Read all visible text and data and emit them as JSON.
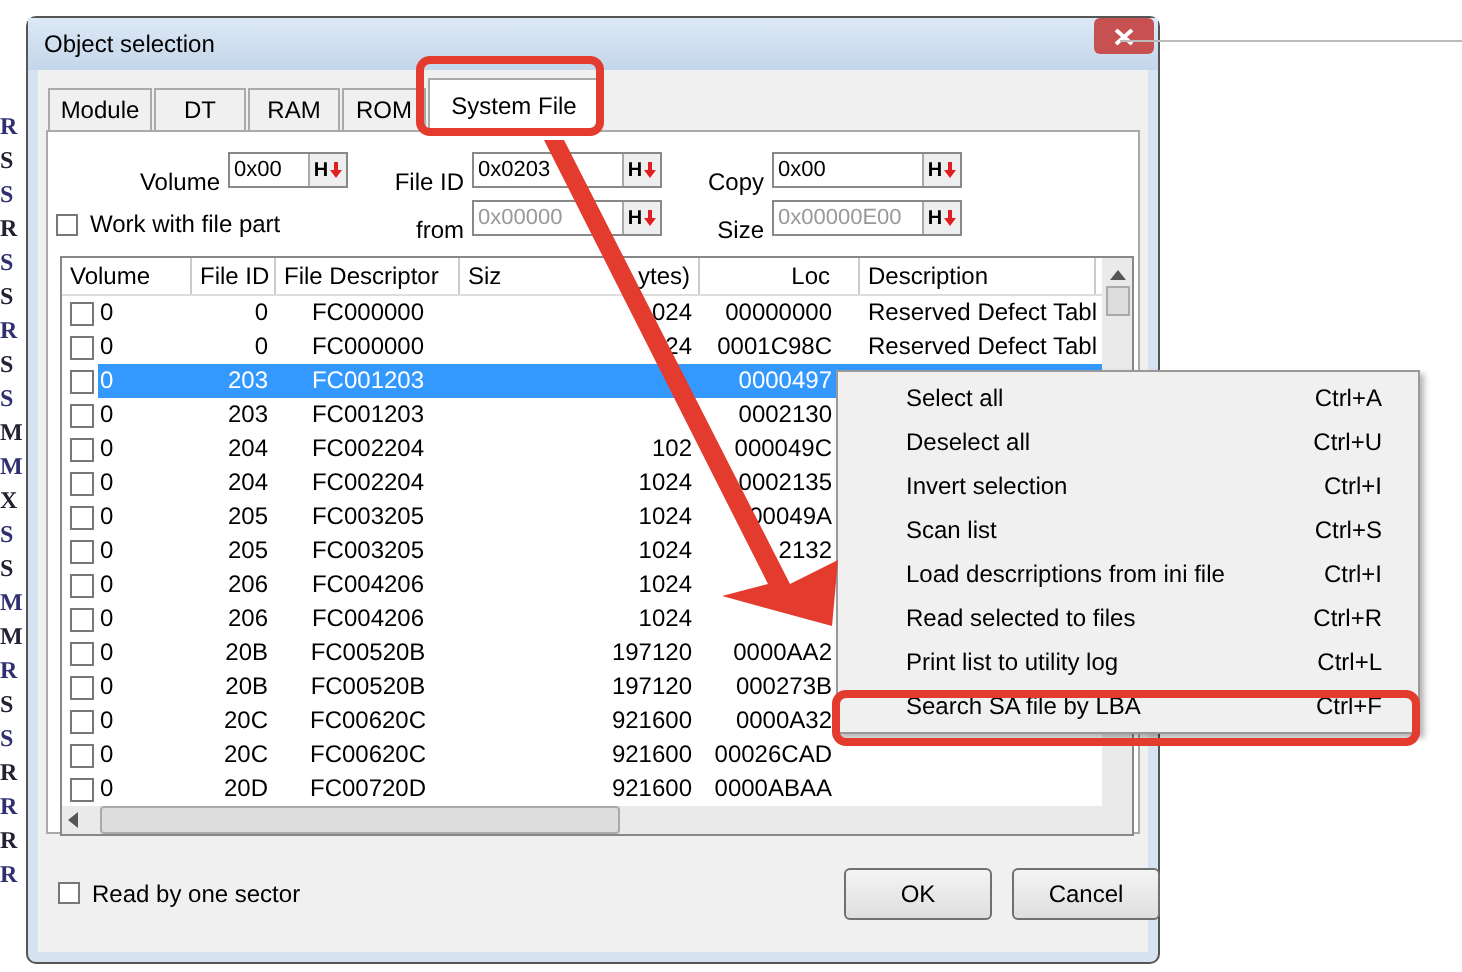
{
  "background_letters": [
    "R",
    "S",
    "S",
    "R",
    "S",
    "S",
    "R",
    "S",
    "S",
    "M",
    "M",
    "X",
    "S",
    "S",
    "M",
    "M",
    "R",
    "S",
    "S",
    "R",
    "R",
    "R",
    "R"
  ],
  "window": {
    "title": "Object selection"
  },
  "tabs": [
    {
      "label": "Module",
      "selected": false
    },
    {
      "label": "DT",
      "selected": false
    },
    {
      "label": "RAM",
      "selected": false
    },
    {
      "label": "ROM",
      "selected": false
    },
    {
      "label": "System File",
      "selected": true
    }
  ],
  "fields_row1": [
    {
      "label": "Volume",
      "value": "0x00",
      "disabled": false,
      "button": "H"
    },
    {
      "label": "File ID",
      "value": "0x0203",
      "disabled": false,
      "button": "H"
    },
    {
      "label": "Copy",
      "value": "0x00",
      "disabled": false,
      "button": "H"
    }
  ],
  "work_with_file_part": {
    "label": "Work with file part",
    "checked": false
  },
  "fields_row2": [
    {
      "label": "from",
      "value": "0x00000",
      "disabled": true,
      "button": "H"
    },
    {
      "label": "Size",
      "value": "0x00000E00",
      "disabled": true,
      "button": "H"
    }
  ],
  "table": {
    "columns": [
      "Volume",
      "File ID",
      "File Descriptor",
      "Siz",
      "Loc",
      "Description"
    ],
    "size_header_tail": "ytes)",
    "rows": [
      {
        "checked": false,
        "selected": false,
        "volume": "0",
        "file_id": "0",
        "descriptor": "FC000000",
        "size": "024",
        "loc": "00000000",
        "description": "Reserved Defect Tabl"
      },
      {
        "checked": false,
        "selected": false,
        "volume": "0",
        "file_id": "0",
        "descriptor": "FC000000",
        "size": "24",
        "loc": "0001C98C",
        "description": "Reserved Defect Tabl"
      },
      {
        "checked": false,
        "selected": true,
        "volume": "0",
        "file_id": "203",
        "descriptor": "FC001203",
        "loc": "0000497"
      },
      {
        "checked": false,
        "selected": false,
        "volume": "0",
        "file_id": "203",
        "descriptor": "FC001203",
        "loc": "0002130"
      },
      {
        "checked": false,
        "selected": false,
        "volume": "0",
        "file_id": "204",
        "descriptor": "FC002204",
        "size": "102",
        "loc": "000049C"
      },
      {
        "checked": false,
        "selected": false,
        "volume": "0",
        "file_id": "204",
        "descriptor": "FC002204",
        "size": "1024",
        "loc": "0002135"
      },
      {
        "checked": false,
        "selected": false,
        "volume": "0",
        "file_id": "205",
        "descriptor": "FC003205",
        "size": "1024",
        "loc": "00049A"
      },
      {
        "checked": false,
        "selected": false,
        "volume": "0",
        "file_id": "205",
        "descriptor": "FC003205",
        "size": "1024",
        "loc": "2132"
      },
      {
        "checked": false,
        "selected": false,
        "volume": "0",
        "file_id": "206",
        "descriptor": "FC004206",
        "size": "1024"
      },
      {
        "checked": false,
        "selected": false,
        "volume": "0",
        "file_id": "206",
        "descriptor": "FC004206",
        "size": "1024"
      },
      {
        "checked": false,
        "selected": false,
        "volume": "0",
        "file_id": "20B",
        "descriptor": "FC00520B",
        "size": "197120",
        "loc": "0000AA2"
      },
      {
        "checked": false,
        "selected": false,
        "volume": "0",
        "file_id": "20B",
        "descriptor": "FC00520B",
        "size": "197120",
        "loc": "000273B"
      },
      {
        "checked": false,
        "selected": false,
        "volume": "0",
        "file_id": "20C",
        "descriptor": "FC00620C",
        "size": "921600",
        "loc": "0000A32"
      },
      {
        "checked": false,
        "selected": false,
        "volume": "0",
        "file_id": "20C",
        "descriptor": "FC00620C",
        "size": "921600",
        "loc": "00026CAD"
      },
      {
        "checked": false,
        "selected": false,
        "volume": "0",
        "file_id": "20D",
        "descriptor": "FC00720D",
        "size": "921600",
        "loc": "0000ABAA"
      }
    ]
  },
  "read_by_one_sector": {
    "label": "Read by one sector",
    "checked": false
  },
  "buttons": [
    "OK",
    "Cancel"
  ],
  "context_menu": [
    {
      "label": "Select all",
      "shortcut": "Ctrl+A",
      "highlighted": false
    },
    {
      "label": "Deselect all",
      "shortcut": "Ctrl+U",
      "highlighted": false
    },
    {
      "label": "Invert selection",
      "shortcut": "Ctrl+I",
      "highlighted": false
    },
    {
      "label": "Scan list",
      "shortcut": "Ctrl+S",
      "highlighted": false
    },
    {
      "label": "Load descrriptions from ini file",
      "shortcut": "Ctrl+I",
      "highlighted": false
    },
    {
      "label": "Read selected to files",
      "shortcut": "Ctrl+R",
      "highlighted": false
    },
    {
      "label": "Print list to utility log",
      "shortcut": "Ctrl+L",
      "highlighted": false
    },
    {
      "label": "Search SA file by LBA",
      "shortcut": "Ctrl+F",
      "highlighted": true
    }
  ]
}
